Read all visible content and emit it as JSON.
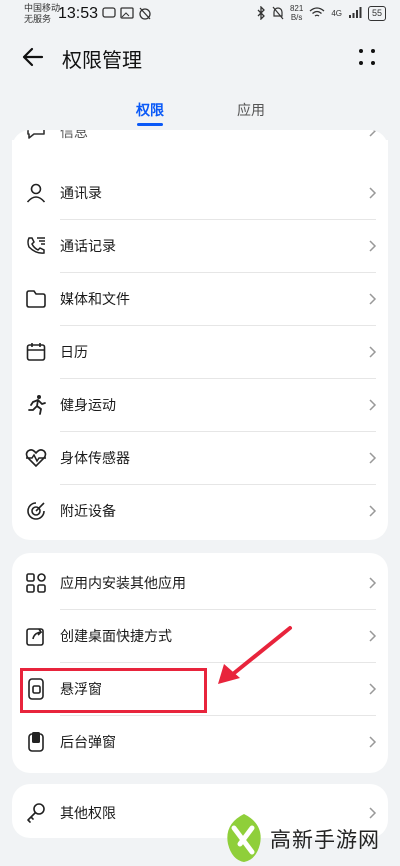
{
  "status_bar": {
    "carrier_line1": "中国移动",
    "carrier_line2": "无服务",
    "time": "13:53",
    "net_speed_value": "821",
    "net_speed_unit": "B/s",
    "signal": "4G",
    "battery": "55"
  },
  "header": {
    "title": "权限管理"
  },
  "tabs": [
    {
      "label": "权限",
      "active": true
    },
    {
      "label": "应用",
      "active": false
    }
  ],
  "partial_item": {
    "label": "信息"
  },
  "group1": [
    {
      "label": "通讯录",
      "icon": "contacts-icon"
    },
    {
      "label": "通话记录",
      "icon": "call-log-icon"
    },
    {
      "label": "媒体和文件",
      "icon": "folder-icon"
    },
    {
      "label": "日历",
      "icon": "calendar-icon"
    },
    {
      "label": "健身运动",
      "icon": "running-icon"
    },
    {
      "label": "身体传感器",
      "icon": "heart-rate-icon"
    },
    {
      "label": "附近设备",
      "icon": "nearby-devices-icon"
    }
  ],
  "group2": [
    {
      "label": "应用内安装其他应用",
      "icon": "install-apps-icon"
    },
    {
      "label": "创建桌面快捷方式",
      "icon": "shortcut-icon"
    },
    {
      "label": "悬浮窗",
      "icon": "floating-window-icon"
    },
    {
      "label": "后台弹窗",
      "icon": "background-popup-icon"
    }
  ],
  "group3": [
    {
      "label": "其他权限",
      "icon": "key-icon"
    }
  ],
  "colors": {
    "accent": "#0a59f7",
    "highlight": "#e8243c"
  },
  "watermark": {
    "text": "高新手游网"
  }
}
